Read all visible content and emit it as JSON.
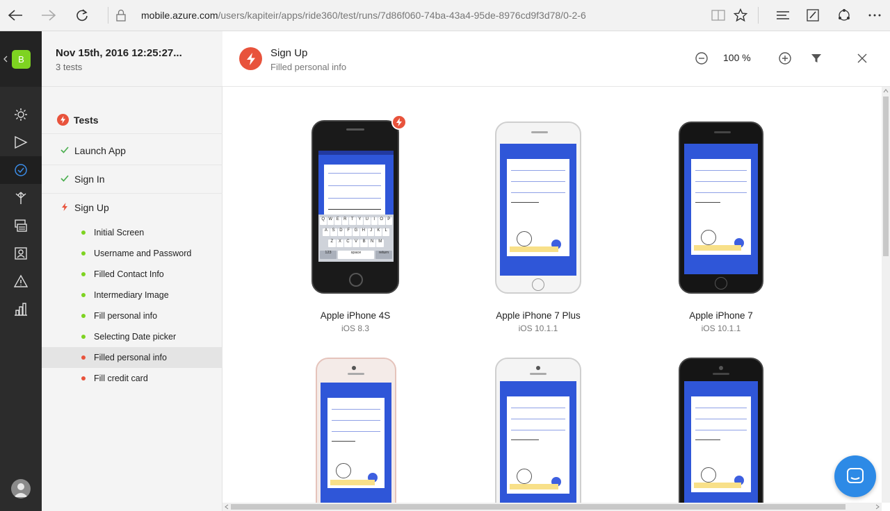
{
  "browser": {
    "url_host": "mobile.azure.com",
    "url_path": "/users/kapiteir/apps/ride360/test/runs/7d86f060-74ba-43a4-95de-8976cd9f3d78/0-2-6"
  },
  "app": {
    "badge_letter": "B",
    "brand_color": "#7ed321"
  },
  "nav": {
    "items": [
      "build-icon",
      "distribute-icon",
      "test-icon",
      "branch-icon",
      "data-icon",
      "contacts-icon",
      "crashes-icon",
      "analytics-icon"
    ],
    "active": "test-icon"
  },
  "run": {
    "title": "Nov 15th, 2016 12:25:27...",
    "subtitle": "3 tests"
  },
  "tests": {
    "heading": "Tests",
    "items": [
      {
        "label": "Launch App",
        "status": "passed"
      },
      {
        "label": "Sign In",
        "status": "passed"
      },
      {
        "label": "Sign Up",
        "status": "failed"
      }
    ],
    "steps": [
      {
        "label": "Initial Screen",
        "status": "passed"
      },
      {
        "label": "Username and Password",
        "status": "passed"
      },
      {
        "label": "Filled Contact Info",
        "status": "passed"
      },
      {
        "label": "Intermediary Image",
        "status": "passed"
      },
      {
        "label": "Fill personal info",
        "status": "passed"
      },
      {
        "label": "Selecting Date picker",
        "status": "passed"
      },
      {
        "label": "Filled personal info",
        "status": "failed",
        "selected": true
      },
      {
        "label": "Fill credit card",
        "status": "failed"
      }
    ]
  },
  "header": {
    "title": "Sign Up",
    "subtitle": "Filled personal info",
    "zoom": "100 %"
  },
  "devices": [
    {
      "name": "Apple iPhone 4S",
      "os": "iOS 8.3",
      "failed": true
    },
    {
      "name": "Apple iPhone 7 Plus",
      "os": "iOS 10.1.1",
      "failed": false
    },
    {
      "name": "Apple iPhone 7",
      "os": "iOS 10.1.1",
      "failed": false
    },
    {
      "name": "",
      "os": "",
      "failed": false
    },
    {
      "name": "",
      "os": "",
      "failed": false
    },
    {
      "name": "",
      "os": "",
      "failed": false
    }
  ],
  "keyboard": {
    "row1": [
      "Q",
      "W",
      "E",
      "R",
      "T",
      "Y",
      "U",
      "I",
      "O",
      "P"
    ],
    "row2": [
      "A",
      "S",
      "D",
      "F",
      "G",
      "H",
      "J",
      "K",
      "L"
    ],
    "row3": [
      "Z",
      "X",
      "C",
      "V",
      "B",
      "N",
      "M"
    ],
    "space": "space",
    "return": "return",
    "alt": "123"
  },
  "colors": {
    "passed": "#7ed321",
    "failed": "#e8533c",
    "screen_blue": "#2f56d8",
    "chat": "#2d8ae6"
  }
}
